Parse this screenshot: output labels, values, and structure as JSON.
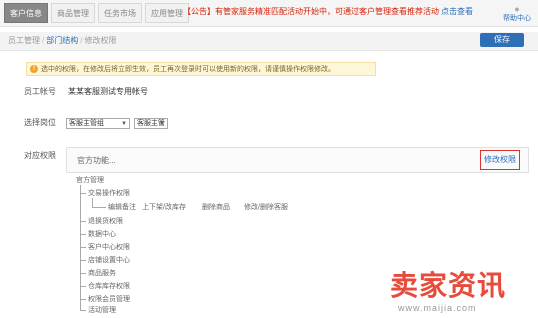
{
  "tabs": [
    {
      "label": "客户信息",
      "active": true
    },
    {
      "label": "商品管理",
      "active": false
    },
    {
      "label": "任务市场",
      "active": false
    },
    {
      "label": "应用管理",
      "active": false
    }
  ],
  "announcement": {
    "text": "【公告】有管家服务精准匹配活动开始中，可通过客户管理查看推荐活动",
    "link": "点击查看"
  },
  "user": {
    "icon": "user-icon",
    "name": "帮助中心"
  },
  "breadcrumb": {
    "first": "员工管理",
    "middle": "部门结构",
    "last": "修改权限"
  },
  "save_label": "保存",
  "hint_text": "选中的权限，在修改后将立即生效，员工再次登录时可以使用新的权限，请谨慎操作权限修改。",
  "form": {
    "name_label": "员工帐号",
    "name_value": "某某客服测试专用帐号",
    "role_label": "选择岗位",
    "dept_value": "客服主管组",
    "role_value": "客服主管",
    "perm_label": "对应权限",
    "perm_text": "官方功能..."
  },
  "modify_label": "修改权限",
  "tree": {
    "root": "官方管理",
    "items": [
      "交易操作权限",
      "退换货权限",
      "数据中心",
      "客户中心权限",
      "店铺设置中心",
      "商品服务",
      "仓库库存权限",
      "权限会员管理",
      "活动管理"
    ],
    "sub": [
      "编辑备注",
      "上下架/改库存",
      "删除商品",
      "修改/删除客服"
    ]
  },
  "watermark": {
    "main": "卖家资讯",
    "url": "www.maijia.com"
  }
}
